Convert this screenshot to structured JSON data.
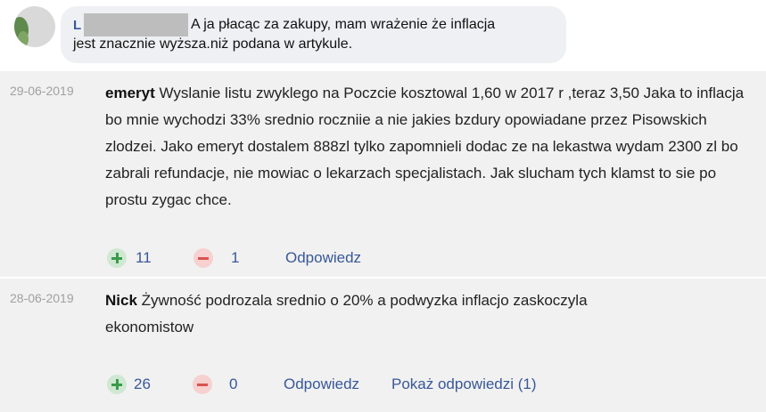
{
  "top_reply": {
    "author_initial": "L",
    "text_line1": "A ja płacąc za zakupy, mam wrażenie że inflacja",
    "text_line2": "jest znacznie wyższa.niż podana w artykule."
  },
  "comments": [
    {
      "date": "29-06-2019",
      "author": "emeryt",
      "text": "Wyslanie listu zwyklego na Poczcie kosztowal 1,60 w 2017 r ,teraz 3,50 Jaka to inflacja bo mnie wychodzi 33% srednio roczniie a nie jakies bzdury opowiadane przez Pisowskich zlodzei. Jako emeryt dostalem 888zl tylko zapomnieli dodac ze na lekastwa wydam 2300 zl bo zabrali refundacje, nie mowiac o lekarzach specjalistach. Jak slucham tych klamst to sie po prostu zygac chce.",
      "upvotes": "11",
      "downvotes": "1",
      "reply_label": "Odpowiedz"
    },
    {
      "date": "28-06-2019",
      "author": "Nick",
      "text": "Żywność podrozala srednio o 20% a podwyzka inflacjo zaskoczyla ekonomistow",
      "upvotes": "26",
      "downvotes": "0",
      "reply_label": "Odpowiedz",
      "show_replies_label": "Pokaż odpowiedzi (1)"
    }
  ],
  "icons": {
    "upvote": "plus-icon",
    "downvote": "minus-icon"
  },
  "colors": {
    "link": "#385898",
    "upvote": "#3a9a4a",
    "downvote": "#d9534f",
    "comment_bg": "#f1f1f1",
    "bubble_bg": "#eef0f3"
  }
}
